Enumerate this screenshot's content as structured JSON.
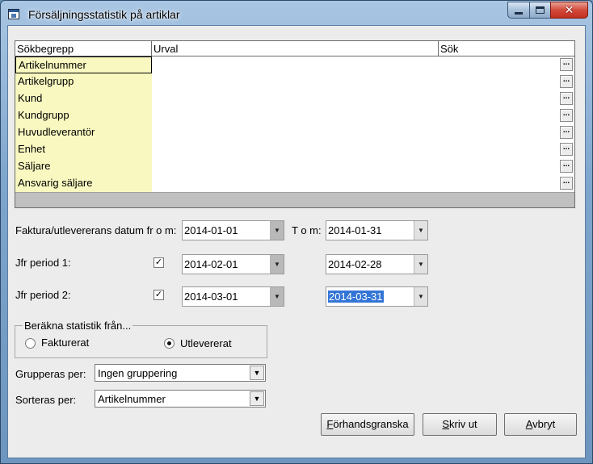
{
  "window": {
    "title": "Försäljningsstatistik på artiklar"
  },
  "grid": {
    "columns": [
      "Sökbegrepp",
      "Urval",
      "Sök"
    ],
    "rows": [
      {
        "label": "Artikelnummer",
        "button": "..."
      },
      {
        "label": "Artikelgrupp",
        "button": "..."
      },
      {
        "label": "Kund",
        "button": "..."
      },
      {
        "label": "Kundgrupp",
        "button": "..."
      },
      {
        "label": "Huvudleverantör",
        "button": "..."
      },
      {
        "label": "Enhet",
        "button": "..."
      },
      {
        "label": "Säljare",
        "button": "..."
      },
      {
        "label": "Ansvarig säljare",
        "button": "..."
      }
    ]
  },
  "dates": {
    "from_label": "Faktura/utlevererans datum fr o m:",
    "to_label": "T o m:",
    "from_value": "2014-01-01",
    "to_value": "2014-01-31",
    "period1_label": "Jfr period 1:",
    "period1_from": "2014-02-01",
    "period1_to": "2014-02-28",
    "period1_checked": true,
    "period2_label": "Jfr period 2:",
    "period2_from": "2014-03-01",
    "period2_to": "2014-03-31",
    "period2_checked": true
  },
  "stats": {
    "group_title": "Beräkna statistik från...",
    "option1": "Fakturerat",
    "option2": "Utlevererat",
    "selected": "Utlevererat"
  },
  "grouping": {
    "label": "Grupperas per:",
    "value": "Ingen gruppering"
  },
  "sorting": {
    "label": "Sorteras per:",
    "value": "Artikelnummer"
  },
  "buttons": {
    "preview_mnemonic": "F",
    "preview_rest": "örhandsgranska",
    "print_mnemonic": "S",
    "print_rest": "kriv ut",
    "cancel_mnemonic": "A",
    "cancel_rest": "vbryt"
  },
  "glyphs": {
    "check": "✓",
    "arrow": "▼",
    "close": "✕"
  }
}
